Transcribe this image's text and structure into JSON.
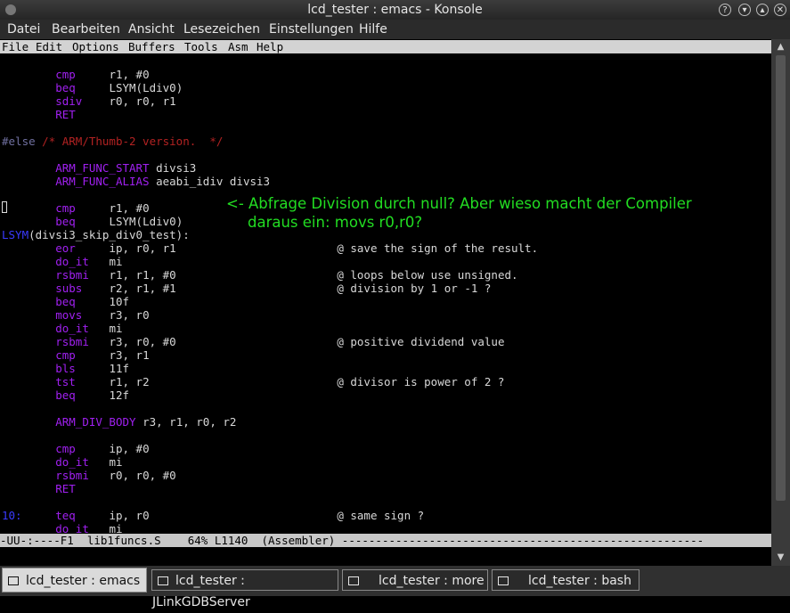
{
  "window": {
    "title": "lcd_tester : emacs - Konsole",
    "menu": [
      "Datei",
      "Bearbeiten",
      "Ansicht",
      "Lesezeichen",
      "Einstellungen",
      "Hilfe"
    ]
  },
  "emacs": {
    "menu": [
      "File",
      "Edit",
      "Options",
      "Buffers",
      "Tools",
      "Asm",
      "Help"
    ],
    "modeline": "-UU-:----F1  lib1funcs.S    64% L1140  (Assembler) ------------------------------------------------------"
  },
  "code": {
    "l1_op": "cmp",
    "l1_arg": "r1, #0",
    "l2_op": "beq",
    "l2_arg": "LSYM(Ldiv0)",
    "l3_op": "sdiv",
    "l3_arg": "r0, r0, r1",
    "l4_op": "RET",
    "l5_pre": "#else",
    "l5_comment": "/* ARM/Thumb-2 version.  */",
    "l6_op": "ARM_FUNC_START",
    "l6_arg": "divsi3",
    "l7_op": "ARM_FUNC_ALIAS",
    "l7_arg": "aeabi_idiv divsi3",
    "l8_op": "cmp",
    "l8_arg": "r1, #0",
    "l9_op": "beq",
    "l9_arg": "LSYM(Ldiv0)",
    "l10_lab": "LSYM",
    "l10_rest": "(divsi3_skip_div0_test):",
    "l11_op": "eor",
    "l11_arg": "ip, r0, r1",
    "l11_c": "@ save the sign of the result.",
    "l12_op": "do_it",
    "l12_arg": "mi",
    "l13_op": "rsbmi",
    "l13_arg": "r1, r1, #0",
    "l13_c": "@ loops below use unsigned.",
    "l14_op": "subs",
    "l14_arg": "r2, r1, #1",
    "l14_c": "@ division by 1 or -1 ?",
    "l15_op": "beq",
    "l15_arg": "10f",
    "l16_op": "movs",
    "l16_arg": "r3, r0",
    "l17_op": "do_it",
    "l17_arg": "mi",
    "l18_op": "rsbmi",
    "l18_arg": "r3, r0, #0",
    "l18_c": "@ positive dividend value",
    "l19_op": "cmp",
    "l19_arg": "r3, r1",
    "l20_op": "bls",
    "l20_arg": "11f",
    "l21_op": "tst",
    "l21_arg": "r1, r2",
    "l21_c": "@ divisor is power of 2 ?",
    "l22_op": "beq",
    "l22_arg": "12f",
    "l23_op": "ARM_DIV_BODY",
    "l23_arg": "r3, r1, r0, r2",
    "l24_op": "cmp",
    "l24_arg": "ip, #0",
    "l25_op": "do_it",
    "l25_arg": "mi",
    "l26_op": "rsbmi",
    "l26_arg": "r0, r0, #0",
    "l27_op": "RET",
    "l28_lab": "10:",
    "l28_op": "teq",
    "l28_arg": "ip, r0",
    "l28_c": "@ same sign ?",
    "l29_op": "do_it",
    "l29_arg": "mi"
  },
  "annotation": {
    "line1": "<- Abfrage Division durch null? Aber wieso macht der Compiler",
    "line2": "daraus ein: movs r0,r0?",
    "color": "#22dd22"
  },
  "tabs": [
    "lcd_tester : emacs",
    "lcd_tester : JLinkGDBServer",
    "lcd_tester : more",
    "lcd_tester : bash"
  ],
  "colors": {
    "keyword": "#a020f0",
    "comment": "#b22222",
    "label": "#3a3aff"
  }
}
